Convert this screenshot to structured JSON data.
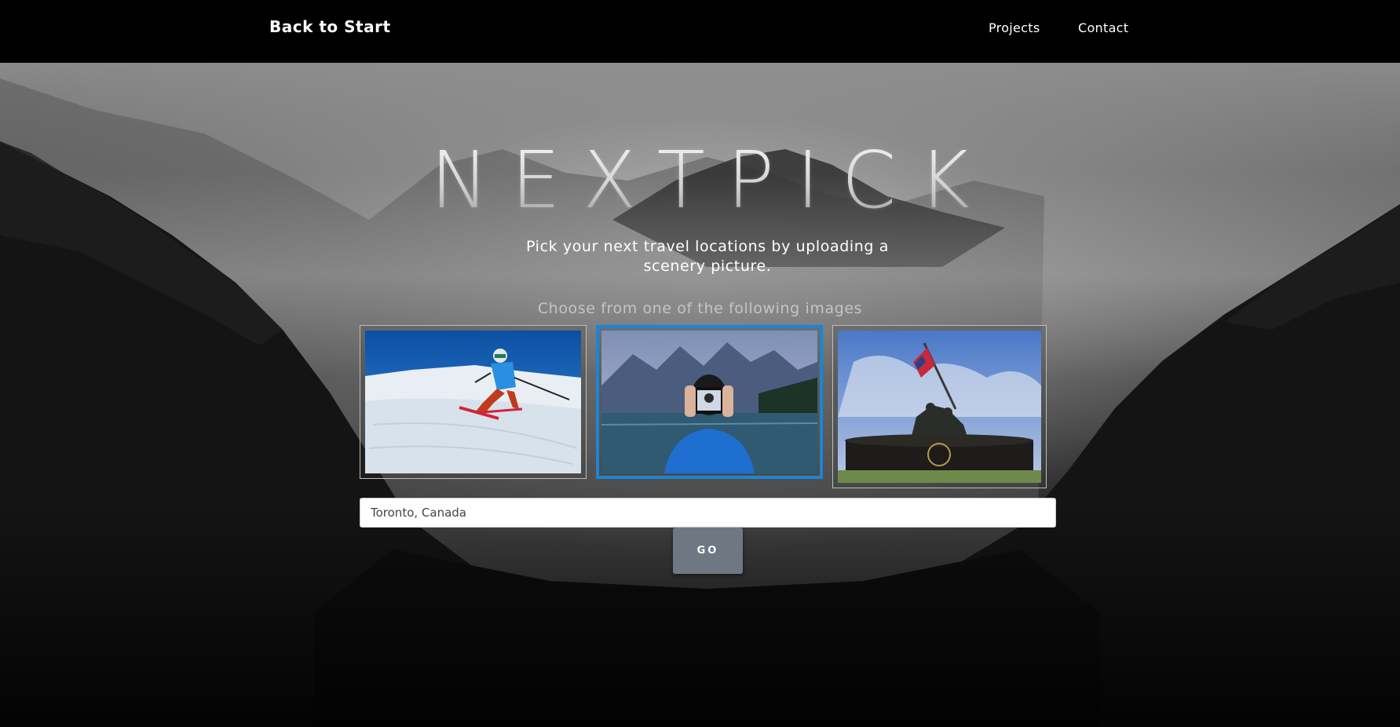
{
  "nav": {
    "brand": "Back to Start",
    "links": [
      {
        "label": "Projects"
      },
      {
        "label": "Contact"
      }
    ]
  },
  "hero": {
    "title": "NEXTPICK",
    "subtitle": "Pick your next travel locations by uploading a scenery picture.",
    "choose_label": "Choose from one of the following images"
  },
  "image_options": [
    {
      "icon": "skier-photo",
      "selected": false
    },
    {
      "icon": "selfie-lake-photo",
      "selected": true
    },
    {
      "icon": "war-memorial-photo",
      "selected": false
    }
  ],
  "search": {
    "value": "Toronto, Canada"
  },
  "go_button": {
    "label": "GO"
  },
  "colors": {
    "selection_border": "#1a86d6",
    "go_button_bg": "#6f7782",
    "nav_bg": "#000000"
  }
}
